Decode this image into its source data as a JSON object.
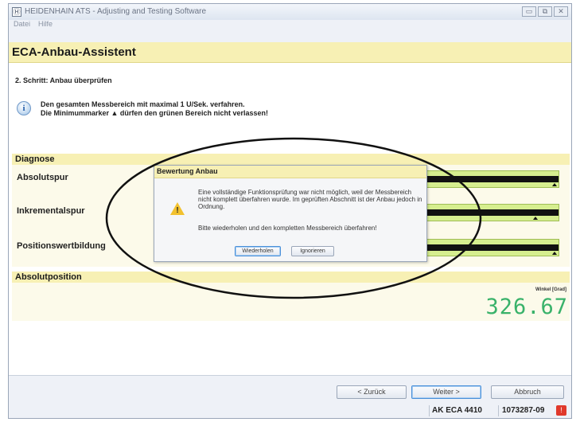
{
  "window": {
    "icon": "heidenhain-app-icon",
    "title": "HEIDENHAIN ATS - Adjusting and Testing Software",
    "controls": [
      "▭",
      "⧉",
      "✕"
    ]
  },
  "menu": [
    "Datei",
    "Hilfe"
  ],
  "header": {
    "title": "ECA-Anbau-Assistent"
  },
  "step": "2. Schritt: Anbau überprüfen",
  "info": {
    "icon": "i",
    "line1": "Den gesamten Messbereich mit maximal 1 U/Sek. verfahren.",
    "line2": "Die Minimummarker ▲ dürfen den grünen Bereich nicht verlassen!"
  },
  "diagnose": {
    "title": "Diagnose",
    "rows": [
      {
        "label": "Absolutspur",
        "meter_color": "#d6ee8f"
      },
      {
        "label": "Inkrementalspur",
        "meter_color": "#d6ee8f"
      },
      {
        "label": "Positionswertbildung",
        "meter_color": "#d6ee8f"
      }
    ]
  },
  "absolutposition": {
    "title": "Absolutposition",
    "unit_label": "Winkel [Grad]",
    "value": "326.67",
    "value_color": "#39b26a"
  },
  "footer": {
    "back_label": "< Zurück",
    "next_label": "Weiter >",
    "cancel_label": "Abbruch",
    "status_model": "AK ECA 4410",
    "status_serial": "1073287-09",
    "status_icon": "!"
  },
  "dialog": {
    "title": "Bewertung Anbau",
    "warning_mark": "!",
    "message": "Eine vollständige Funktionsprüfung war nicht möglich, weil der Messbereich nicht komplett überfahren wurde. Im geprüften Abschnitt ist der Anbau jedoch in Ordnung.",
    "message2": "Bitte wiederholen und den kompletten Messbereich überfahren!",
    "retry_label": "Wiederholen",
    "ignore_label": "Ignorieren"
  },
  "colors": {
    "accent_yellow": "#f7f0b4",
    "meter_green": "#d6ee8f",
    "value_green": "#39b26a",
    "warning_yellow": "#f2c12e",
    "status_red": "#e0392b"
  }
}
